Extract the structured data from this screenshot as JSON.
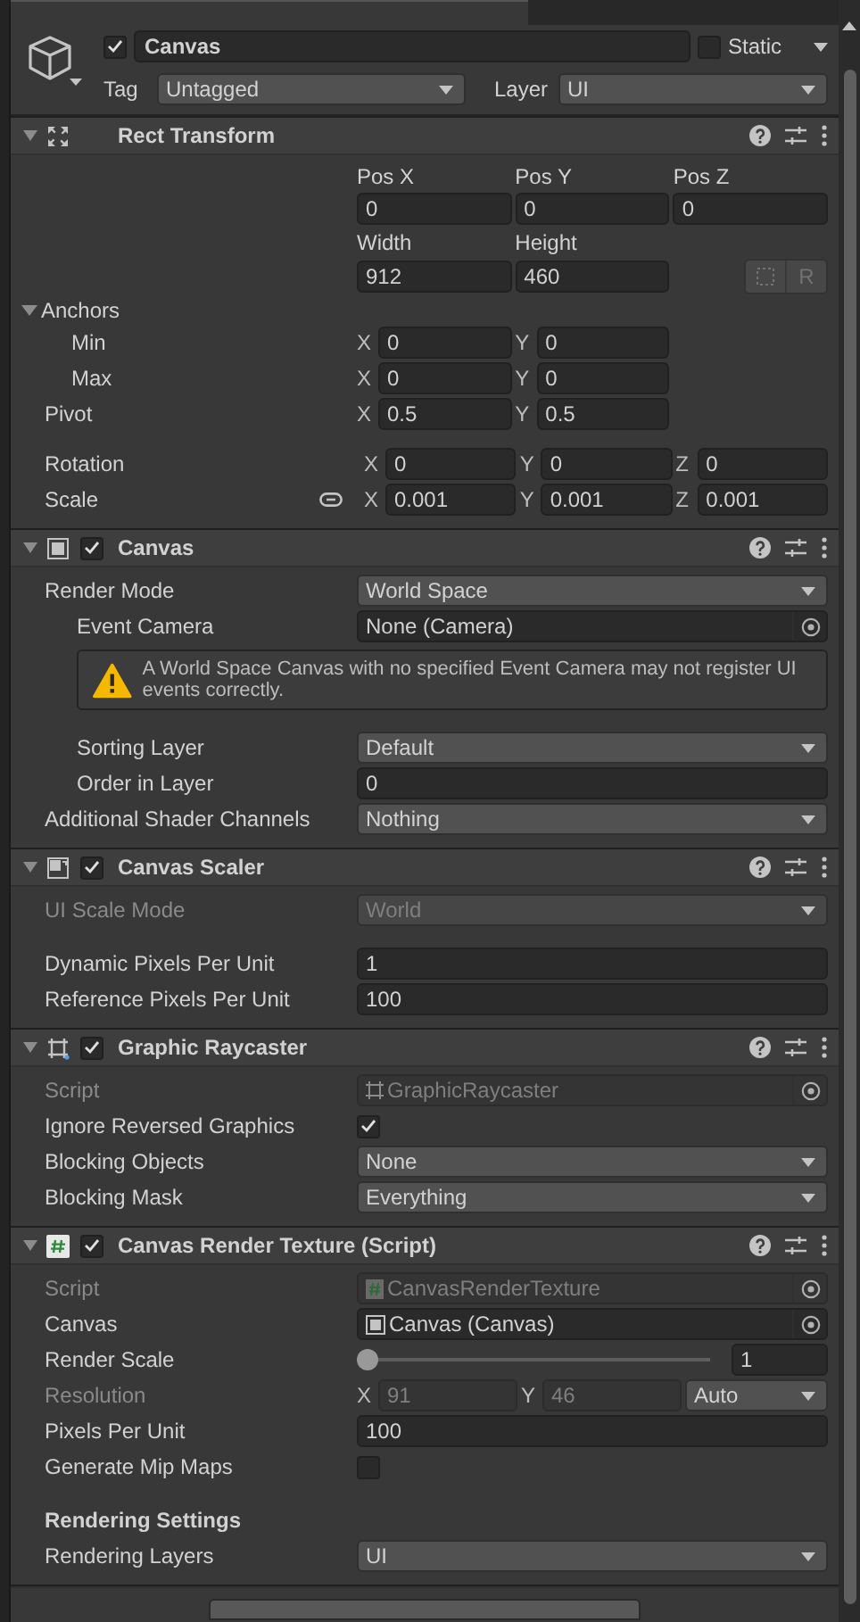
{
  "game_object": {
    "active": true,
    "name": "Canvas",
    "static": false,
    "static_label": "Static",
    "tag_label": "Tag",
    "tag": "Untagged",
    "layer_label": "Layer",
    "layer": "UI"
  },
  "components": [
    {
      "kind": "rect_transform",
      "title": "Rect Transform",
      "expanded": true,
      "position": [
        {
          "label": "Pos X",
          "value": "0"
        },
        {
          "label": "Pos Y",
          "value": "0"
        },
        {
          "label": "Pos Z",
          "value": "0"
        }
      ],
      "size": [
        {
          "label": "Width",
          "value": "912"
        },
        {
          "label": "Height",
          "value": "460"
        }
      ],
      "blueprint_label": "R",
      "anchors": {
        "label": "Anchors",
        "expanded": true,
        "rows": [
          {
            "label": "Min",
            "axes": [
              {
                "axis": "X",
                "value": "0"
              },
              {
                "axis": "Y",
                "value": "0"
              }
            ]
          },
          {
            "label": "Max",
            "axes": [
              {
                "axis": "X",
                "value": "0"
              },
              {
                "axis": "Y",
                "value": "0"
              }
            ]
          }
        ]
      },
      "pivot": {
        "label": "Pivot",
        "axes": [
          {
            "axis": "X",
            "value": "0.5"
          },
          {
            "axis": "Y",
            "value": "0.5"
          }
        ]
      },
      "rotation": {
        "label": "Rotation",
        "axes": [
          {
            "axis": "X",
            "value": "0"
          },
          {
            "axis": "Y",
            "value": "0"
          },
          {
            "axis": "Z",
            "value": "0"
          }
        ]
      },
      "scale": {
        "label": "Scale",
        "axes": [
          {
            "axis": "X",
            "value": "0.001"
          },
          {
            "axis": "Y",
            "value": "0.001"
          },
          {
            "axis": "Z",
            "value": "0.001"
          }
        ]
      }
    },
    {
      "kind": "canvas",
      "title": "Canvas",
      "expanded": true,
      "enabled": true,
      "rows": [
        {
          "kind": "dropdown",
          "label": "Render Mode",
          "value": "World Space",
          "indent": false,
          "disabled": false,
          "spaced": false
        },
        {
          "kind": "object",
          "label": "Event Camera",
          "value": "None (Camera)",
          "indent": true,
          "disabled": false,
          "spaced": false
        },
        {
          "kind": "warning",
          "text": "A World Space Canvas with no specified Event Camera may not register UI events correctly.",
          "indent": true,
          "disabled": false,
          "spaced": false
        },
        {
          "kind": "dropdown",
          "label": "Sorting Layer",
          "value": "Default",
          "indent": true,
          "disabled": false,
          "spaced": true
        },
        {
          "kind": "field",
          "label": "Order in Layer",
          "value": "0",
          "indent": true,
          "disabled": false,
          "spaced": false
        },
        {
          "kind": "dropdown",
          "label": "Additional Shader Channels",
          "value": "Nothing",
          "indent": false,
          "disabled": false,
          "spaced": false
        }
      ]
    },
    {
      "kind": "canvas_scaler",
      "title": "Canvas Scaler",
      "expanded": true,
      "enabled": true,
      "rows": [
        {
          "kind": "dropdown",
          "label": "UI Scale Mode",
          "value": "World",
          "indent": false,
          "disabled": true,
          "spaced": false
        },
        {
          "kind": "field",
          "label": "Dynamic Pixels Per Unit",
          "value": "1",
          "indent": false,
          "disabled": false,
          "spaced": true
        },
        {
          "kind": "field",
          "label": "Reference Pixels Per Unit",
          "value": "100",
          "indent": false,
          "disabled": false,
          "spaced": false
        }
      ]
    },
    {
      "kind": "graphic_raycaster",
      "title": "Graphic Raycaster",
      "expanded": true,
      "enabled": true,
      "rows": [
        {
          "kind": "object_raycaster",
          "label": "Script",
          "value": "GraphicRaycaster",
          "indent": false,
          "disabled": true,
          "spaced": false
        },
        {
          "kind": "checkbox",
          "label": "Ignore Reversed Graphics",
          "checked": true,
          "indent": false,
          "disabled": false,
          "spaced": false
        },
        {
          "kind": "dropdown",
          "label": "Blocking Objects",
          "value": "None",
          "indent": false,
          "disabled": false,
          "spaced": false
        },
        {
          "kind": "dropdown",
          "label": "Blocking Mask",
          "value": "Everything",
          "indent": false,
          "disabled": false,
          "spaced": false
        }
      ]
    },
    {
      "kind": "script",
      "title": "Canvas Render Texture (Script)",
      "expanded": true,
      "enabled": true,
      "rows": [
        {
          "kind": "object_script",
          "label": "Script",
          "value": "CanvasRenderTexture",
          "indent": false,
          "disabled": true,
          "spaced": false
        },
        {
          "kind": "object_canvas",
          "label": "Canvas",
          "value": "Canvas (Canvas)",
          "indent": false,
          "disabled": false,
          "spaced": false
        },
        {
          "kind": "slider",
          "label": "Render Scale",
          "level": 0,
          "value": "1",
          "indent": false,
          "disabled": false,
          "spaced": false
        },
        {
          "kind": "resolution",
          "label": "Resolution",
          "axes": [
            {
              "axis": "X",
              "value": "91"
            },
            {
              "axis": "Y",
              "value": "46"
            }
          ],
          "mode": "Auto",
          "indent": false,
          "disabled": true,
          "spaced": false
        },
        {
          "kind": "field",
          "label": "Pixels Per Unit",
          "value": "100",
          "indent": false,
          "disabled": false,
          "spaced": false
        },
        {
          "kind": "checkbox",
          "label": "Generate Mip Maps",
          "checked": false,
          "indent": false,
          "disabled": false,
          "spaced": false
        },
        {
          "kind": "header",
          "label": "Rendering Settings",
          "indent": false,
          "disabled": false,
          "spaced": true
        },
        {
          "kind": "dropdown",
          "label": "Rendering Layers",
          "value": "UI",
          "indent": false,
          "disabled": false,
          "spaced": false
        }
      ]
    }
  ]
}
